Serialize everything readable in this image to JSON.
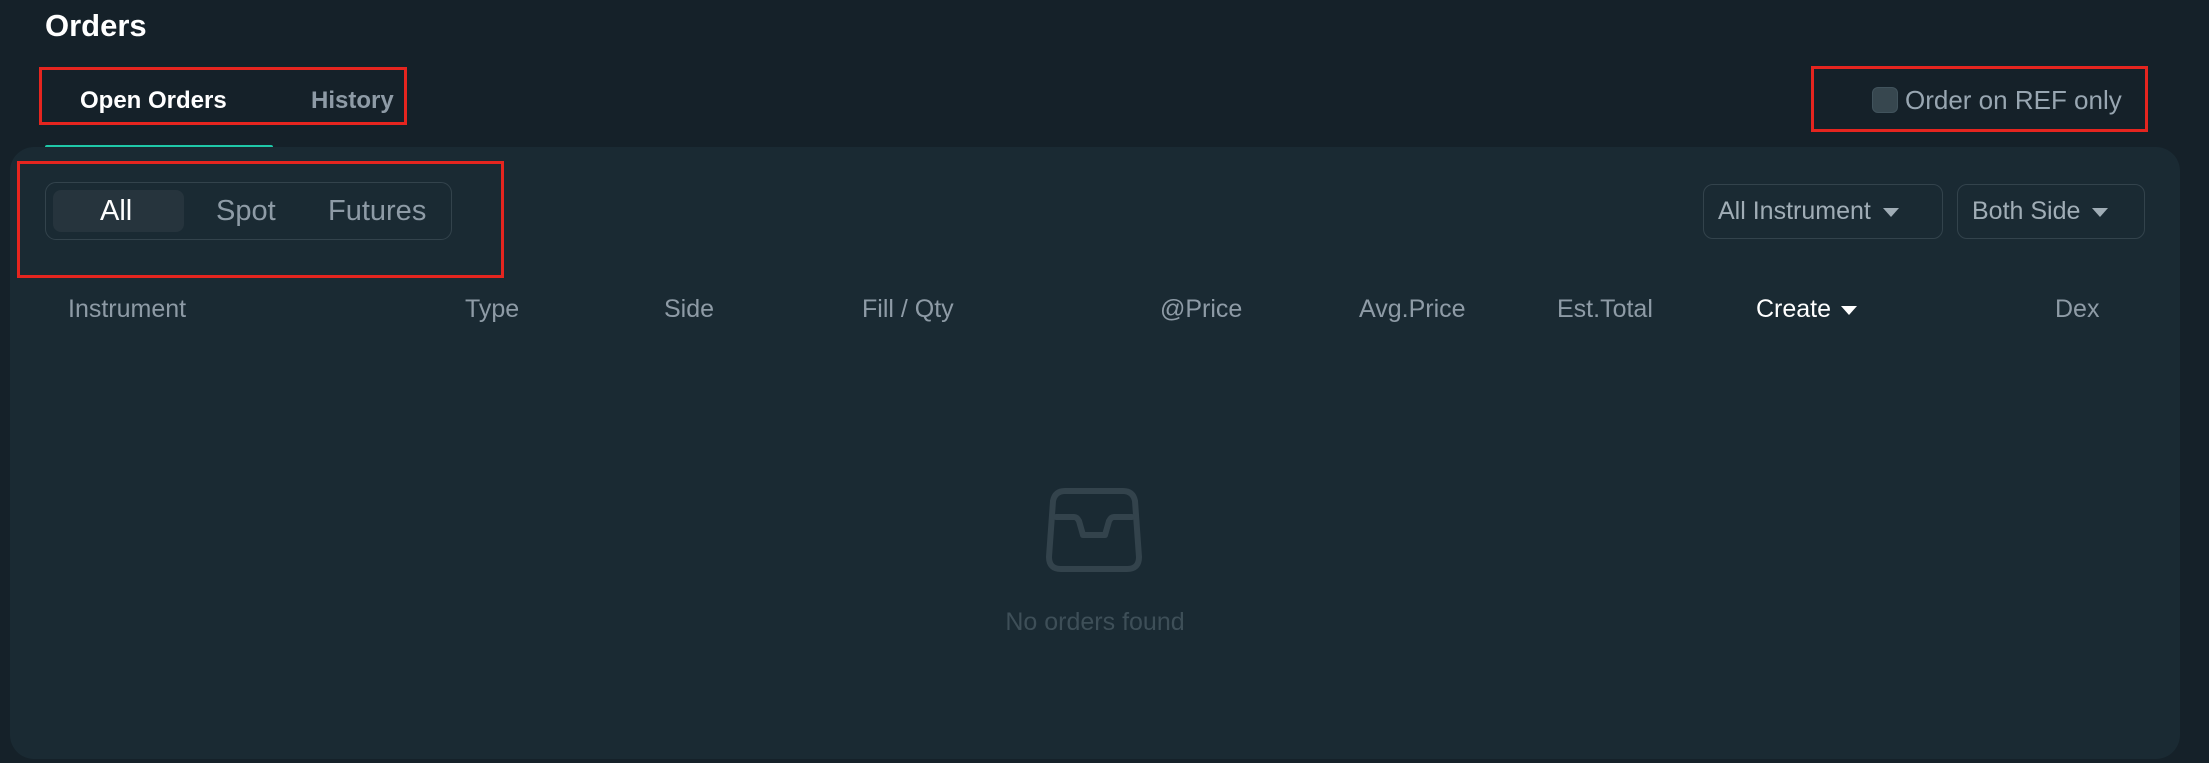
{
  "header": {
    "title": "Orders"
  },
  "tabs": [
    {
      "label": "Open Orders",
      "active": true
    },
    {
      "label": "History",
      "active": false
    }
  ],
  "ref_filter": {
    "label": "Order on REF only",
    "checked": false
  },
  "market_filter": {
    "options": [
      "All",
      "Spot",
      "Futures"
    ],
    "selected": "All"
  },
  "dropdowns": {
    "instrument": "All Instrument",
    "side": "Both Side"
  },
  "table": {
    "columns": [
      "Instrument",
      "Type",
      "Side",
      "Fill / Qty",
      "@Price",
      "Avg.Price",
      "Est.Total",
      "Create",
      "Dex"
    ],
    "sort_column": "Create",
    "rows": []
  },
  "empty_state": {
    "icon": "inbox-icon",
    "message": "No orders found"
  },
  "colors": {
    "background": "#152129",
    "panel": "#1a2a33",
    "accent": "#1fc8a8",
    "highlight_box": "#e5251f"
  }
}
